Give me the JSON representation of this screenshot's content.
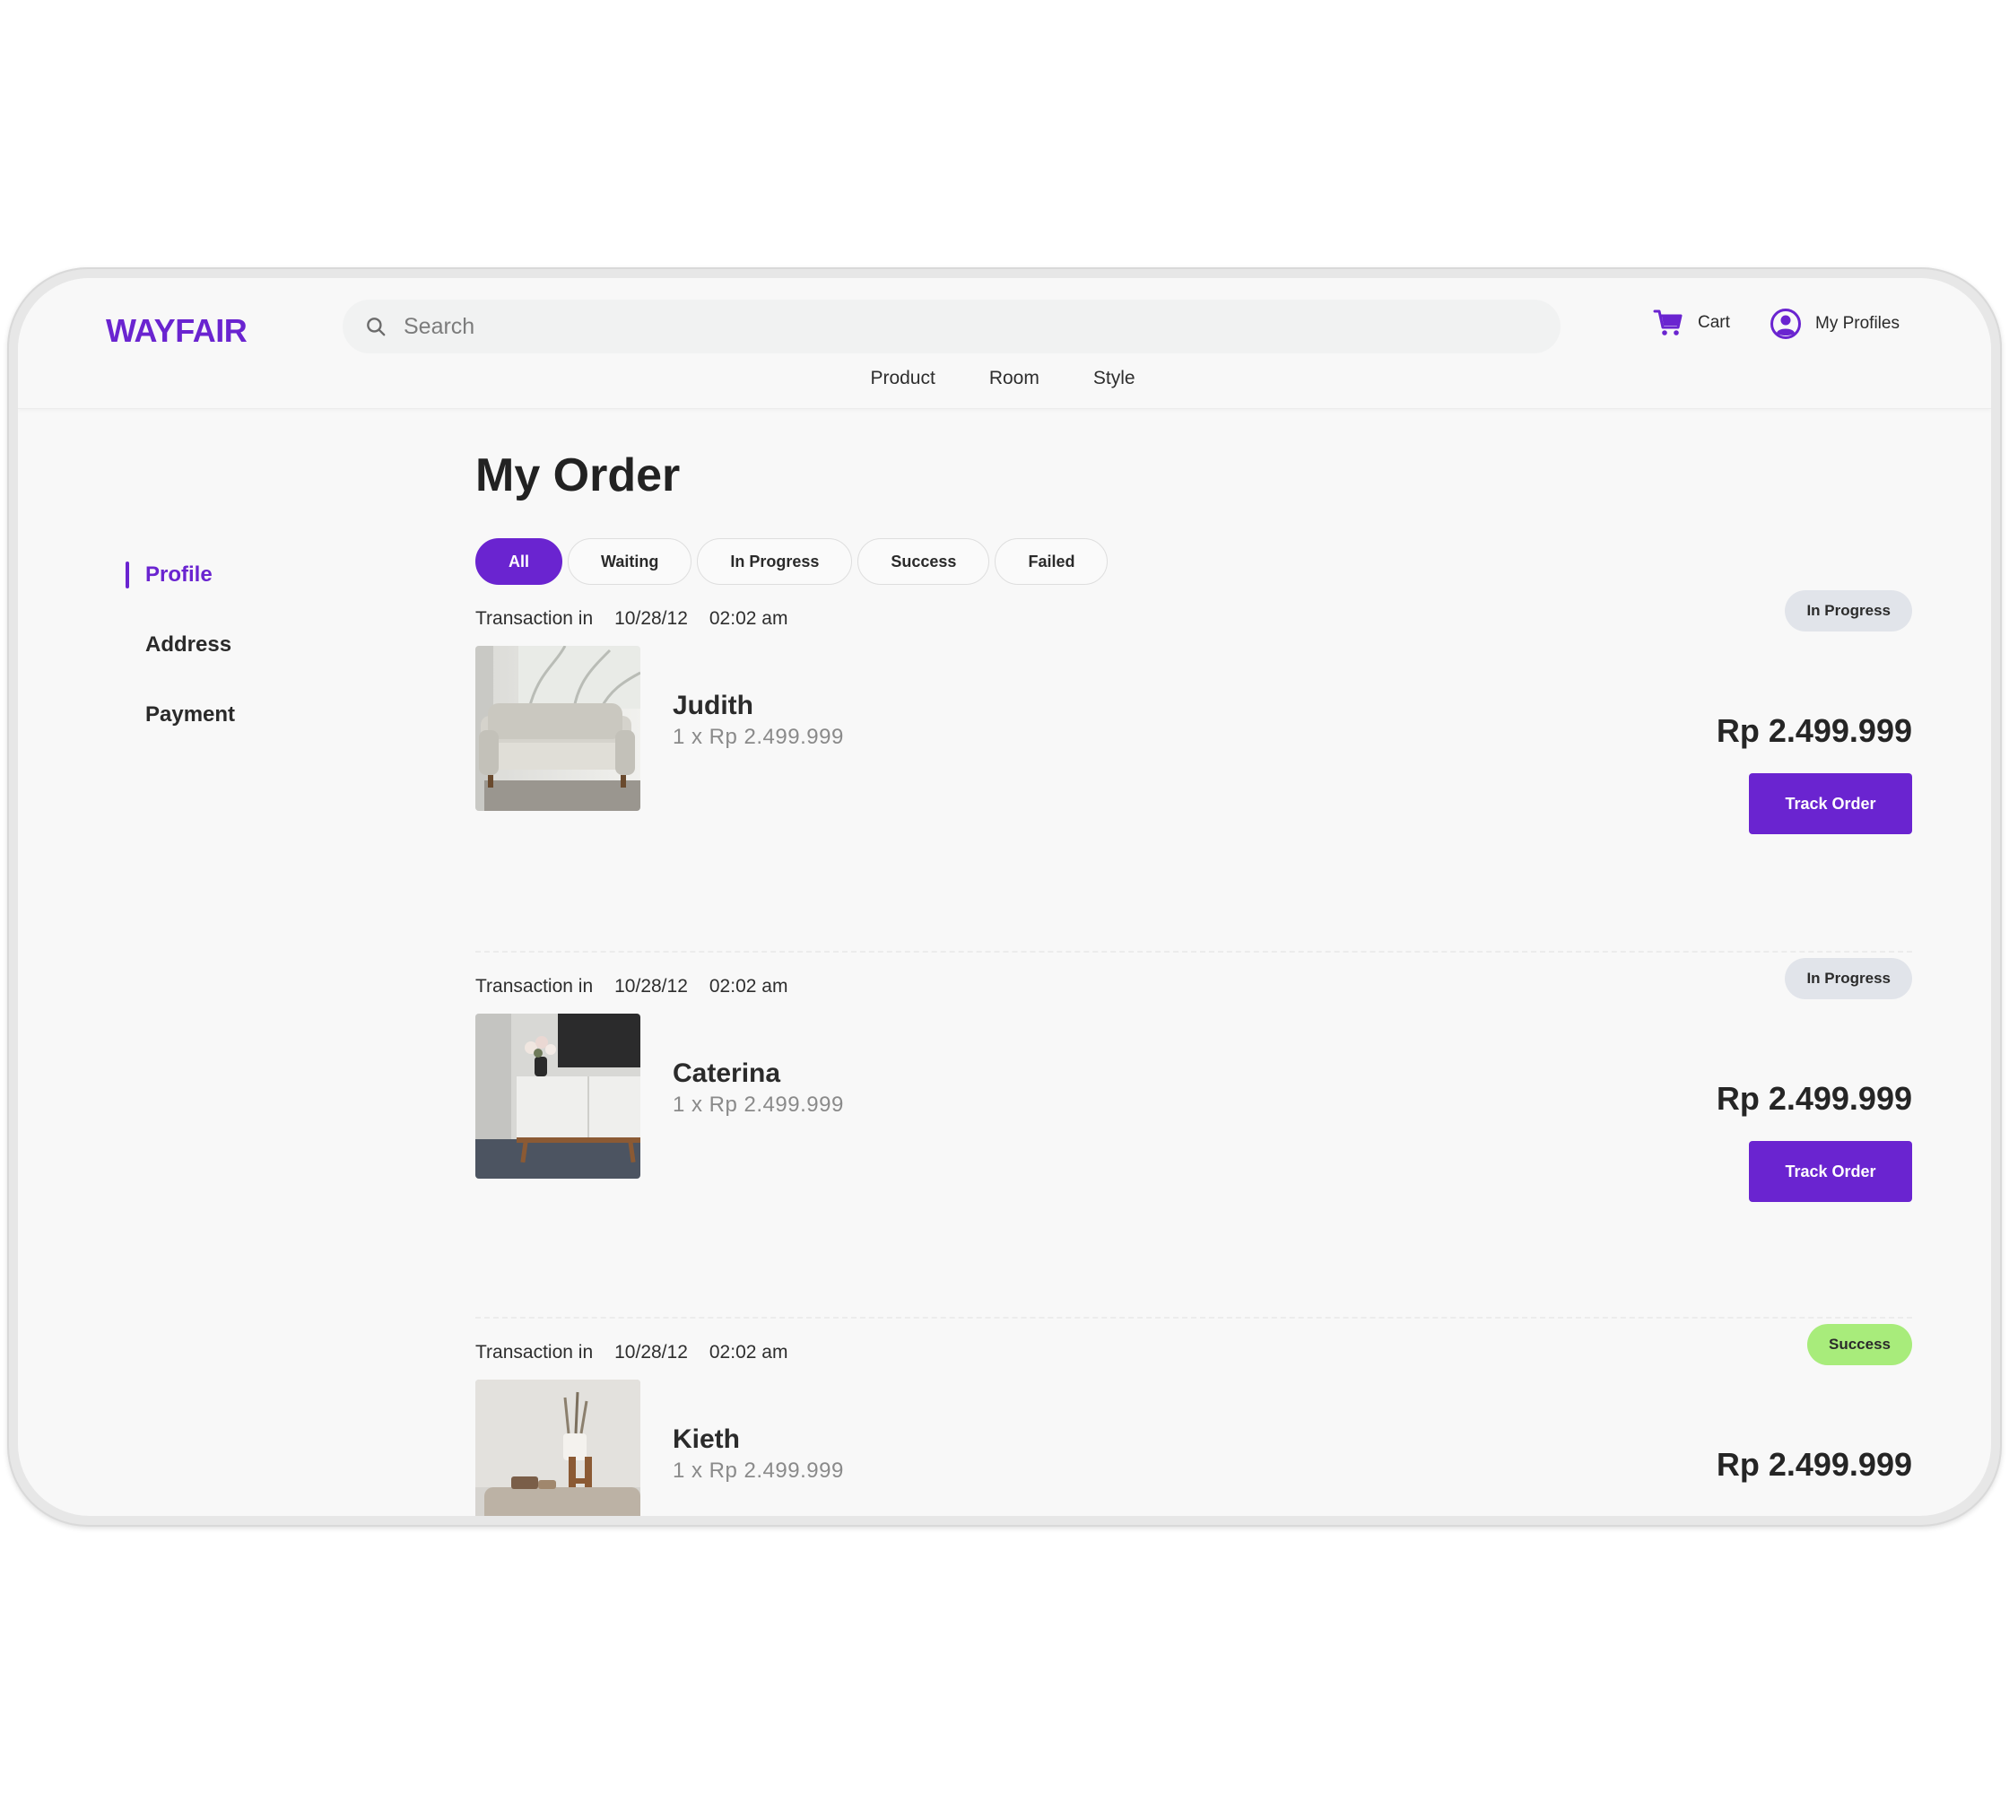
{
  "brand": {
    "name": "WAYFAIR",
    "color": "#6a24d0"
  },
  "search": {
    "placeholder": "Search",
    "icon": "search-icon"
  },
  "header": {
    "cart_label": "Cart",
    "profile_label": "My Profiles",
    "nav": [
      "Product",
      "Room",
      "Style"
    ]
  },
  "sidebar": {
    "items": [
      {
        "label": "Profile",
        "active": true
      },
      {
        "label": "Address",
        "active": false
      },
      {
        "label": "Payment",
        "active": false
      }
    ]
  },
  "main": {
    "title": "My Order",
    "filters": [
      {
        "label": "All",
        "active": true
      },
      {
        "label": "Waiting",
        "active": false
      },
      {
        "label": "In Progress",
        "active": false
      },
      {
        "label": "Success",
        "active": false
      },
      {
        "label": "Failed",
        "active": false
      }
    ],
    "orders": [
      {
        "tx_label": "Transaction in",
        "date": "10/28/12",
        "time": "02:02 am",
        "status": "In Progress",
        "status_color": "#e1e4ea",
        "name": "Judith",
        "qty": "1 x Rp 2.499.999",
        "price": "Rp 2.499.999",
        "action": "Track Order",
        "image": "sofa"
      },
      {
        "tx_label": "Transaction in",
        "date": "10/28/12",
        "time": "02:02 am",
        "status": "In Progress",
        "status_color": "#e1e4ea",
        "name": "Caterina",
        "qty": "1 x Rp 2.499.999",
        "price": "Rp 2.499.999",
        "action": "Track Order",
        "image": "tv-cabinet"
      },
      {
        "tx_label": "Transaction in",
        "date": "10/28/12",
        "time": "02:02 am",
        "status": "Success",
        "status_color": "#a8ec7b",
        "name": "Kieth",
        "qty": "1 x Rp 2.499.999",
        "price": "Rp 2.499.999",
        "image": "side-table"
      }
    ]
  }
}
